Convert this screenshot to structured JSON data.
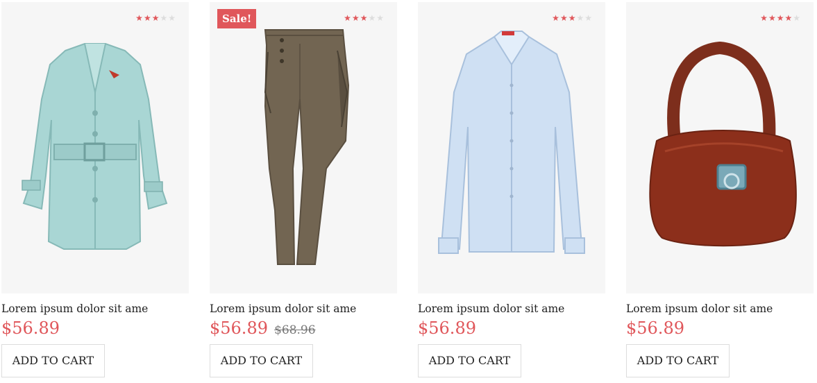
{
  "products": [
    {
      "title": "Lorem ipsum dolor sit ame",
      "price": "$56.89",
      "rating": 3,
      "rating_max": 5,
      "image_icon": "coat-image",
      "cart_label": "ADD TO CART"
    },
    {
      "title": "Lorem ipsum dolor sit ame",
      "price": "$56.89",
      "old_price": "$68.96",
      "badge": "Sale!",
      "rating": 3,
      "rating_max": 5,
      "image_icon": "pants-image",
      "cart_label": "ADD TO CART"
    },
    {
      "title": "Lorem ipsum dolor sit ame",
      "price": "$56.89",
      "rating": 3,
      "rating_max": 5,
      "image_icon": "shirt-image",
      "cart_label": "ADD TO CART"
    },
    {
      "title": "Lorem ipsum dolor sit ame",
      "price": "$56.89",
      "rating": 4,
      "rating_max": 5,
      "image_icon": "handbag-image",
      "cart_label": "ADD TO CART"
    }
  ],
  "colors": {
    "accent": "#e0575b",
    "star_off": "#dddddd",
    "card_bg": "#f6f6f6"
  }
}
